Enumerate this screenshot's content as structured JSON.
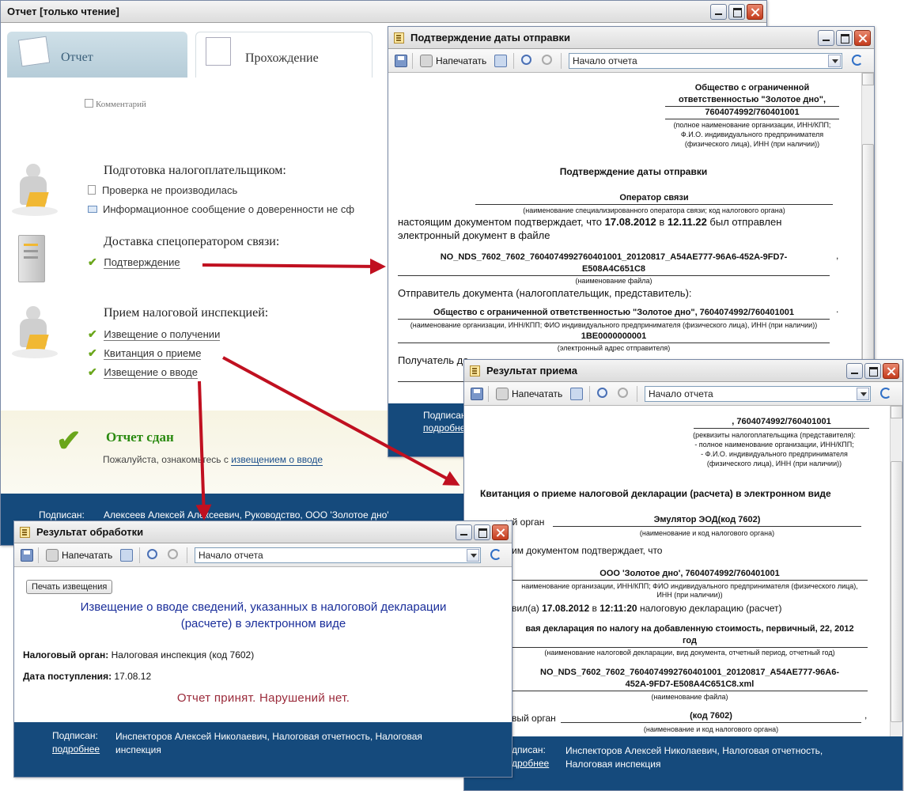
{
  "main_window": {
    "title": "Отчет [только чтение]",
    "tabs": [
      {
        "label": "Отчет"
      },
      {
        "label": "Прохождение"
      }
    ],
    "comment_label": "Комментарий",
    "sections": [
      {
        "title": "Подготовка налогоплательщиком:",
        "items": [
          {
            "text": "Проверка не производилась",
            "status": "doc"
          },
          {
            "text": "Информационное сообщение о доверенности не сф",
            "status": "envelope"
          }
        ]
      },
      {
        "title": "Доставка спецоператором связи:",
        "items": [
          {
            "text": "Подтверждение",
            "status": "check"
          }
        ]
      },
      {
        "title": "Прием налоговой инспекцией:",
        "items": [
          {
            "text": "Извещение о получении",
            "status": "check"
          },
          {
            "text": "Квитанция о приеме",
            "status": "check"
          },
          {
            "text": "Извещение о вводе",
            "status": "check"
          }
        ]
      }
    ],
    "status_title": "Отчет сдан",
    "status_text_prefix": "Пожалуйста, ознакомьтесь с",
    "status_link": "извещением о вводе",
    "signed_label": "Подписан:",
    "signed_by": "Алексеев Алексей Алексеевич, Руководство, ООО 'Золотое дно'"
  },
  "confirm_window": {
    "title": "Подтверждение даты отправки",
    "print_label": "Напечатать",
    "nav_value": "Начало отчета",
    "org_lines": [
      "Общество с ограниченной",
      "ответственностью \"Золотое дно\",",
      "7604074992/760401001"
    ],
    "org_caption": [
      "(полное наименование организации, ИНН/КПП;",
      "Ф.И.О. индивидуального предпринимателя",
      "(физического лица), ИНН (при наличии))"
    ],
    "heading": "Подтверждение даты отправки",
    "operator": "Оператор связи",
    "operator_caption": "(наименование специализированного оператора связи; код налогового органа)",
    "text1_a": "настоящим документом подтверждает, что",
    "text1_date": "17.08.2012",
    "text1_b": "в",
    "text1_time": "12.11.22",
    "text1_c": "был отправлен",
    "text2": "электронный документ в файле",
    "filename": [
      "NO_NDS_7602_7602_7604074992760401001_20120817_A54AE777-96A6-452A-9FD7-",
      "E508A4C651C8"
    ],
    "filename_comma": ",",
    "filename_caption": "(наименование файла)",
    "sender_label": "Отправитель документа (налогоплательщик, представитель):",
    "sender": "Общество с ограниченной ответственностью \"Золотое дно\", 7604074992/760401001",
    "sender_dot": ".",
    "sender_caption": "(наименование организации, ИНН/КПП; ФИО индивидуального предпринимателя (физического лица), ИНН (при наличии))",
    "sender_addr": "1BE0000000001",
    "sender_addr_caption": "(электронный адрес отправителя)",
    "receiver_label": "Получатель до",
    "signed_label": "Подписан",
    "more_link": "подробне"
  },
  "result_window": {
    "title": "Результат приема",
    "print_label": "Напечатать",
    "nav_value": "Начало отчета",
    "req_value": ", 7604074992/760401001",
    "req_caption": [
      "(реквизиты налогоплательщика (представителя):",
      "- полное наименование организации, ИНН/КПП;",
      "- Ф.И.О. индивидуального предпринимателя",
      "(физического лица), ИНН (при наличии))"
    ],
    "heading": "Квитанция о приеме налоговой декларации (расчета) в электронном виде",
    "organ_label": "ый орган",
    "organ_value": "Эмулятор ЭОД(код 7602)",
    "organ_caption": "(наименование и код налогового органа)",
    "confirm_text": "им документом подтверждает, что",
    "org_value": "ООО 'Золотое дно', 7604074992/760401001",
    "org_caption": [
      "наименование организации, ИНН/КПП; ФИО индивидуального предпринимателя (физического лица),",
      "ИНН (при наличии))"
    ],
    "submitted_a": "вил(а)",
    "submitted_date": "17.08.2012",
    "submitted_b": "в",
    "submitted_time": "12:11:20",
    "submitted_c": "налоговую декларацию (расчет)",
    "decl_line1": "вая декларация по налогу на добавленную стоимость, первичный, 22, 2012",
    "decl_line2": "год",
    "decl_caption": "(наименование налоговой декларации, вид документа, отчетный период, отчетный год)",
    "file_line1": "NO_NDS_7602_7602_7604074992760401001_20120817_A54AE777-96A6-",
    "file_line2": "452A-9FD7-E508A4C651C8.xml",
    "file_caption": "(наименование файла)",
    "organ2_label": "вый орган",
    "organ2_value": "(код 7602)",
    "organ2_comma": ",",
    "organ2_caption": "(наименование и код налогового органа)",
    "signed_label": "дписан:",
    "more_link": "дробнее",
    "signed_by": [
      "Инспекторов Алексей Николаевич, Налоговая отчетность,",
      "Налоговая инспекция"
    ]
  },
  "process_window": {
    "title": "Результат обработки",
    "print_label": "Напечатать",
    "nav_value": "Начало отчета",
    "print_notice_button": "Печать извещения",
    "heading": [
      "Извещение о вводе сведений, указанных в налоговой декларации",
      "(расчете) в электронном виде"
    ],
    "tax_organ_label": "Налоговый орган:",
    "tax_organ_value": "Налоговая инспекция (код 7602)",
    "date_label": "Дата поступления:",
    "date_value": "17.08.12",
    "result_text": "Отчет принят. Нарушений нет.",
    "signed_label": "Подписан:",
    "more_link": "подробнее",
    "signed_by": [
      "Инспекторов Алексей Николаевич, Налоговая отчетность, Налоговая",
      "инспекция"
    ]
  },
  "colors": {
    "accent_blue": "#154a7c",
    "check_green": "#6aa61b",
    "arrow_red": "#c01020",
    "heading_blue": "#1a2e9a",
    "result_red": "#9a2a3a",
    "status_green": "#2a8a10"
  }
}
